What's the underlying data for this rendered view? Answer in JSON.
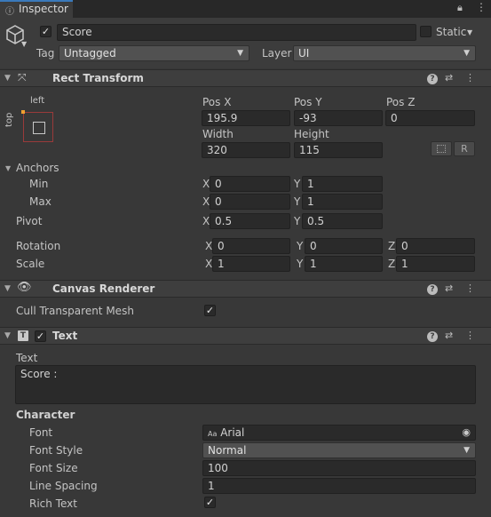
{
  "tab": {
    "title": "Inspector"
  },
  "object": {
    "name": "Score",
    "static_label": "Static",
    "tag_label": "Tag",
    "tag_value": "Untagged",
    "layer_label": "Layer",
    "layer_value": "UI"
  },
  "rect_transform": {
    "title": "Rect Transform",
    "anchor_h": "left",
    "anchor_v": "top",
    "pos_x_label": "Pos X",
    "pos_x": "195.9",
    "pos_y_label": "Pos Y",
    "pos_y": "-93",
    "pos_z_label": "Pos Z",
    "pos_z": "0",
    "width_label": "Width",
    "width": "320",
    "height_label": "Height",
    "height": "115",
    "r_button": "R",
    "anchors_label": "Anchors",
    "min_label": "Min",
    "min_x": "0",
    "min_y": "1",
    "max_label": "Max",
    "max_x": "0",
    "max_y": "1",
    "pivot_label": "Pivot",
    "pivot_x": "0.5",
    "pivot_y": "0.5",
    "rotation_label": "Rotation",
    "rot_x": "0",
    "rot_y": "0",
    "rot_z": "0",
    "scale_label": "Scale",
    "scale_x": "1",
    "scale_y": "1",
    "scale_z": "1",
    "x": "X",
    "y": "Y",
    "z": "Z"
  },
  "canvas_renderer": {
    "title": "Canvas Renderer",
    "cull_label": "Cull Transparent Mesh"
  },
  "text_component": {
    "title": "Text",
    "text_label": "Text",
    "text_value": "Score :",
    "character_label": "Character",
    "font_label": "Font",
    "font_value": "Arial",
    "font_icon": "Aa",
    "font_style_label": "Font Style",
    "font_style_value": "Normal",
    "font_size_label": "Font Size",
    "font_size_value": "100",
    "line_spacing_label": "Line Spacing",
    "line_spacing_value": "1",
    "rich_text_label": "Rich Text"
  },
  "glyphs": {
    "check": "✓",
    "fold": "▼",
    "dropdown": "▼",
    "help": "?",
    "menu": "⋮",
    "presets": "⇄"
  },
  "colors": {
    "background": "#383838",
    "header": "#3e3e3e",
    "field": "#2a2a2a",
    "accent": "#f0a030"
  }
}
